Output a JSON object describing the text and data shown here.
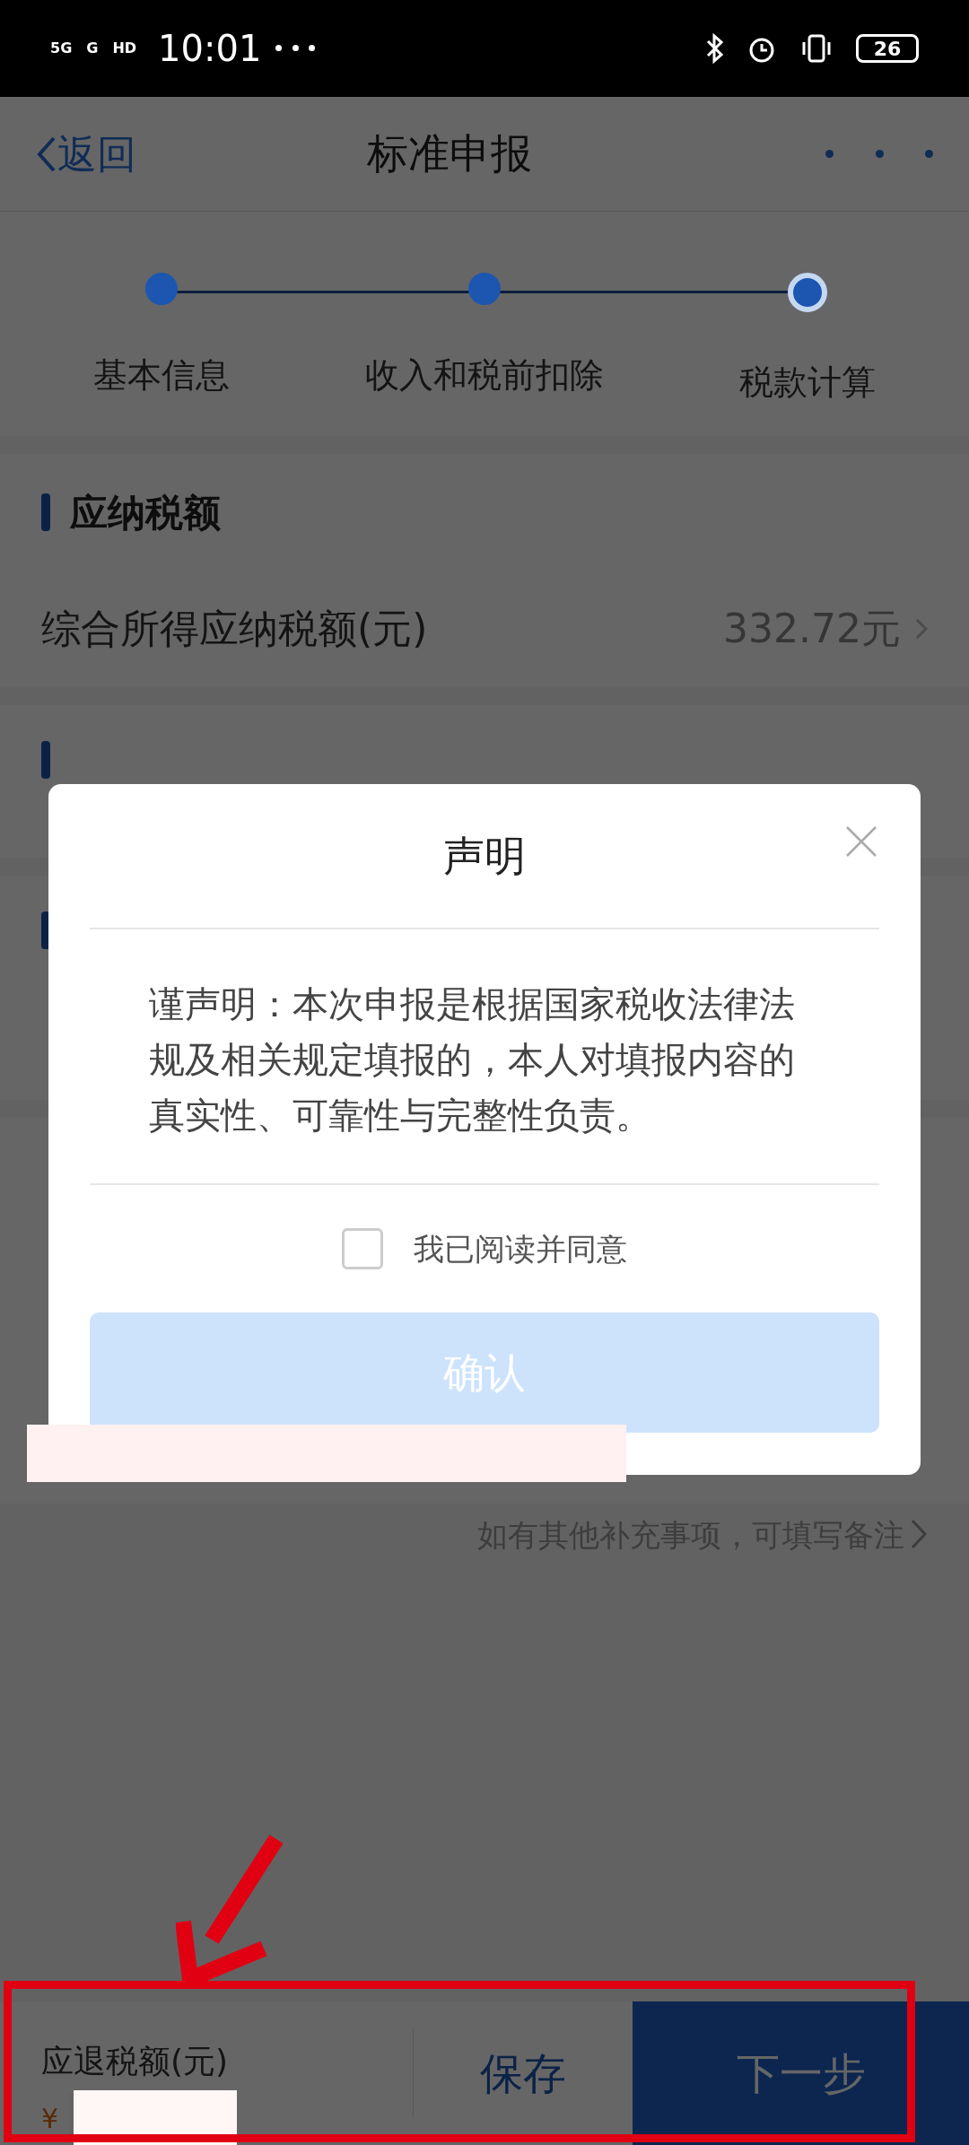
{
  "status_bar": {
    "left_icons": [
      "5G",
      "G",
      "HD"
    ],
    "time": "10:01",
    "battery": "26"
  },
  "nav": {
    "back": "返回",
    "title": "标准申报"
  },
  "steps": [
    {
      "label": "基本信息",
      "done": true,
      "current": false
    },
    {
      "label": "收入和税前扣除",
      "done": true,
      "current": false
    },
    {
      "label": "税款计算",
      "done": true,
      "current": true
    }
  ],
  "section": {
    "title": "应纳税额"
  },
  "row": {
    "label": "综合所得应纳税额(元)",
    "value": "332.72元"
  },
  "note_link": "如有其他补充事项，可填写备注",
  "dialog": {
    "title": "声明",
    "body": "谨声明：本次申报是根据国家税收法律法规及相关规定填报的，本人对填报内容的真实性、可靠性与完整性负责。",
    "agree": {
      "label": "我已阅读并同意",
      "checked": false
    },
    "confirm": {
      "label": "确认",
      "disabled": true
    }
  },
  "bottom_bar": {
    "label": "应退税额(元)",
    "currency": "¥",
    "save": "保存",
    "next": "下一步"
  }
}
